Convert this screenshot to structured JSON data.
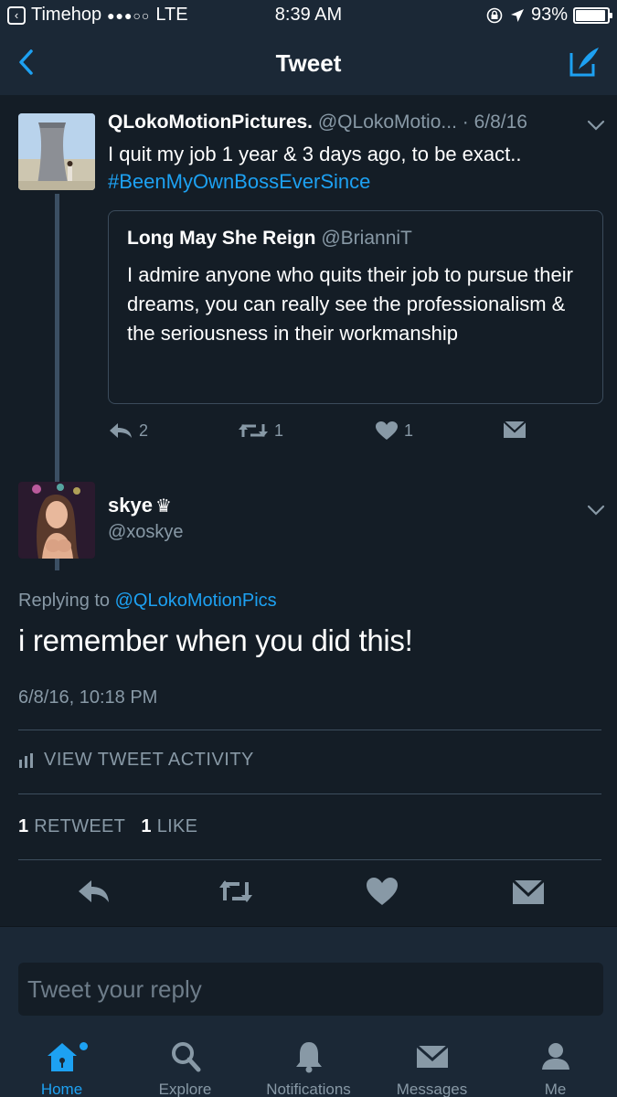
{
  "status_bar": {
    "carrier": "Timehop",
    "signal": "●●●○○",
    "network": "LTE",
    "time": "8:39 AM",
    "battery": "93%",
    "battery_level": 0.93
  },
  "nav": {
    "title": "Tweet"
  },
  "parent_tweet": {
    "name": "QLokoMotionPictures.",
    "handle": "@QLokoMotio...",
    "date": "· 6/8/16",
    "text": "I quit my job 1 year & 3 days ago, to be exact..",
    "hashtag": "#BeenMyOwnBossEverSince",
    "quote": {
      "name": "Long May She Reign",
      "handle": "@BrianniT",
      "text": "I admire anyone who quits their job to pursue their dreams, you can really see the professionalism & the seriousness in their workmanship"
    },
    "replies": "2",
    "retweets": "1",
    "likes": "1"
  },
  "reply_tweet": {
    "name": "skye",
    "name_emoji": "♛",
    "handle": "@xoskye",
    "replying_prefix": "Replying to",
    "replying_to": "@QLokoMotionPics",
    "text": "i remember when you did this!",
    "timestamp": "6/8/16, 10:18 PM",
    "activity_label": "VIEW TWEET ACTIVITY",
    "retweet_count": "1",
    "retweet_label": "RETWEET",
    "like_count": "1",
    "like_label": "LIKE"
  },
  "composer": {
    "placeholder": "Tweet your reply"
  },
  "tabs": [
    {
      "label": "Home",
      "icon": "home-icon"
    },
    {
      "label": "Explore",
      "icon": "search-icon"
    },
    {
      "label": "Notifications",
      "icon": "bell-icon"
    },
    {
      "label": "Messages",
      "icon": "envelope-icon"
    },
    {
      "label": "Me",
      "icon": "person-icon"
    }
  ],
  "colors": {
    "background": "#141d26",
    "bar": "#1b2836",
    "accent": "#1da1f2",
    "secondary_text": "#8899a6"
  }
}
